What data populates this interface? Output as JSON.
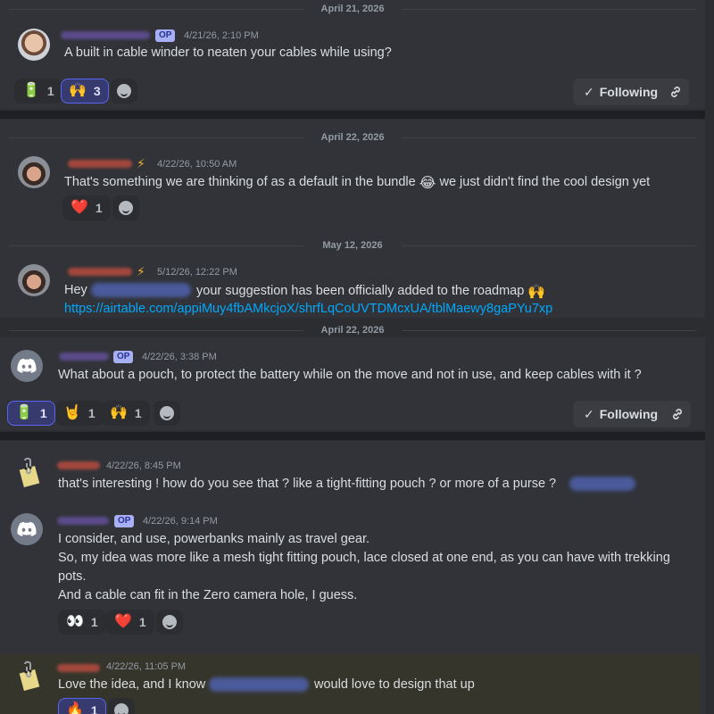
{
  "thread1": {
    "date": "April 21, 2026",
    "op_badge": "OP",
    "timestamp": "4/21/26, 2:10 PM",
    "message": "A built in cable winder to neaten your cables while using?",
    "reactions": [
      {
        "emoji": "🔋",
        "count": "1",
        "active": false
      },
      {
        "emoji": "🙌",
        "count": "3",
        "active": true
      }
    ],
    "following_label": "Following"
  },
  "reply1": {
    "date": "April 22, 2026",
    "timestamp": "4/22/26, 10:50 AM",
    "message_a": "That's something we are thinking of as a default in the bundle",
    "emoji": "😂",
    "message_b": " we just didn't find the cool design yet",
    "reactions": [
      {
        "emoji": "❤️",
        "count": "1"
      }
    ]
  },
  "reply2": {
    "date": "May 12, 2026",
    "timestamp": "5/12/26, 12:22 PM",
    "message_a": "Hey",
    "message_b": "your suggestion has been officially added to the roadmap",
    "emoji": "🙌",
    "link": "https://airtable.com/appiMuy4fbAMkcjoX/shrfLqCoUVTDMcxUA/tblMaewy8gaPYu7xp"
  },
  "thread2": {
    "date": "April 22, 2026",
    "op_badge": "OP",
    "timestamp": "4/22/26, 3:38 PM",
    "message": "What about a pouch, to protect the battery while on the move and not in use, and keep cables with it ?",
    "reactions": [
      {
        "emoji": "🔋",
        "count": "1",
        "active": true
      },
      {
        "emoji": "🤘",
        "count": "1",
        "active": false
      },
      {
        "emoji": "🙌",
        "count": "1",
        "active": false
      }
    ],
    "following_label": "Following"
  },
  "reply3": {
    "timestamp": "4/22/26, 8:45 PM",
    "message": "that's interesting ! how do you see that ? like a tight-fitting pouch ? or more of a purse ?"
  },
  "reply4": {
    "op_badge": "OP",
    "timestamp": "4/22/26, 9:14 PM",
    "lines": [
      "I consider, and use,  powerbanks mainly as travel gear.",
      "So, my idea was more like a mesh tight fitting pouch, lace closed at one end, as you can have with trekking",
      "pots.",
      "And a cable can fit in the Zero camera hole, I guess."
    ],
    "reactions": [
      {
        "emoji": "👀",
        "count": "1"
      },
      {
        "emoji": "❤️",
        "count": "1"
      }
    ]
  },
  "reply5": {
    "timestamp": "4/22/26, 11:05 PM",
    "message_a": "Love the idea, and I know",
    "message_b": "would love to design that up",
    "reactions": [
      {
        "emoji": "🔥",
        "count": "1"
      }
    ]
  }
}
